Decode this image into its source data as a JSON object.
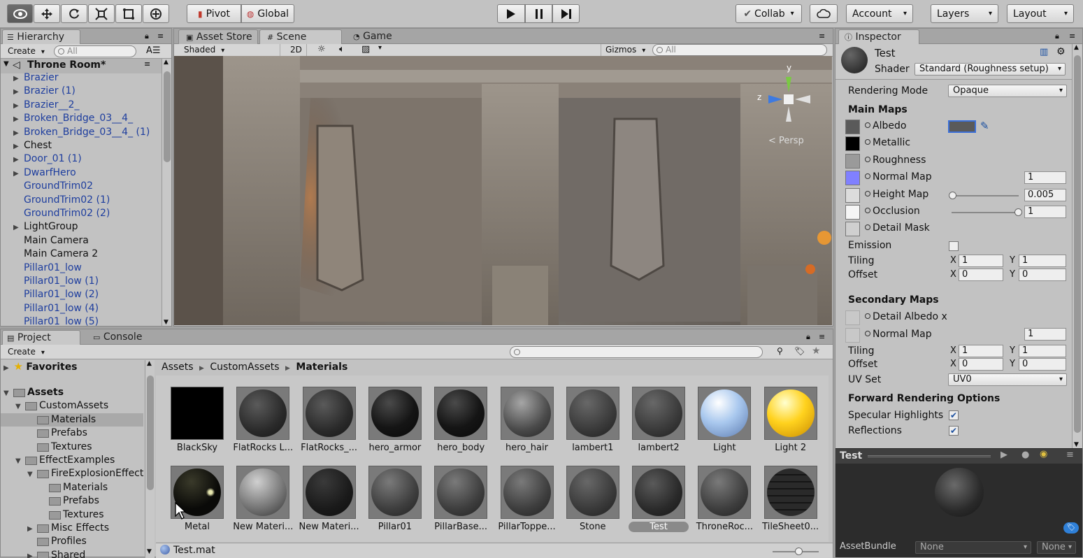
{
  "toolbar": {
    "pivot": "Pivot",
    "global": "Global",
    "collab": "Collab",
    "account": "Account",
    "layers": "Layers",
    "layout": "Layout"
  },
  "hierarchy": {
    "tab": "Hierarchy",
    "create": "Create",
    "search_placeholder": "All",
    "scene_name": "Throne Room*",
    "items": [
      {
        "label": "Brazier",
        "prefab": true,
        "expandable": true
      },
      {
        "label": "Brazier (1)",
        "prefab": true,
        "expandable": true
      },
      {
        "label": "Brazier__2_",
        "prefab": true,
        "expandable": true
      },
      {
        "label": "Broken_Bridge_03__4_",
        "prefab": true,
        "expandable": true
      },
      {
        "label": "Broken_Bridge_03__4_ (1)",
        "prefab": true,
        "expandable": true
      },
      {
        "label": "Chest",
        "prefab": false,
        "expandable": true
      },
      {
        "label": "Door_01 (1)",
        "prefab": true,
        "expandable": true
      },
      {
        "label": "DwarfHero",
        "prefab": true,
        "expandable": true
      },
      {
        "label": "GroundTrim02",
        "prefab": true,
        "expandable": false
      },
      {
        "label": "GroundTrim02 (1)",
        "prefab": true,
        "expandable": false
      },
      {
        "label": "GroundTrim02 (2)",
        "prefab": true,
        "expandable": false
      },
      {
        "label": "LightGroup",
        "prefab": false,
        "expandable": true
      },
      {
        "label": "Main Camera",
        "prefab": false,
        "expandable": false
      },
      {
        "label": "Main Camera 2",
        "prefab": false,
        "expandable": false
      },
      {
        "label": "Pillar01_low",
        "prefab": true,
        "expandable": false
      },
      {
        "label": "Pillar01_low (1)",
        "prefab": true,
        "expandable": false
      },
      {
        "label": "Pillar01_low (2)",
        "prefab": true,
        "expandable": false
      },
      {
        "label": "Pillar01_low (4)",
        "prefab": true,
        "expandable": false
      },
      {
        "label": "Pillar01_low (5)",
        "prefab": true,
        "expandable": false
      }
    ]
  },
  "scene_view": {
    "tabs": [
      "Asset Store",
      "Scene",
      "Game"
    ],
    "shading": "Shaded",
    "mode_2d": "2D",
    "gizmos": "Gizmos",
    "search_placeholder": "All",
    "persp": "< Persp",
    "axis_y": "y",
    "axis_z": "z"
  },
  "project": {
    "tabs": [
      "Project",
      "Console"
    ],
    "create": "Create",
    "favorites": "Favorites",
    "tree": [
      {
        "label": "Assets",
        "depth": 0,
        "open": true,
        "bold": true
      },
      {
        "label": "CustomAssets",
        "depth": 1,
        "open": true
      },
      {
        "label": "Materials",
        "depth": 2,
        "selected": true
      },
      {
        "label": "Prefabs",
        "depth": 2
      },
      {
        "label": "Textures",
        "depth": 2
      },
      {
        "label": "EffectExamples",
        "depth": 1,
        "open": true
      },
      {
        "label": "FireExplosionEffects",
        "depth": 2,
        "open": true
      },
      {
        "label": "Materials",
        "depth": 3
      },
      {
        "label": "Prefabs",
        "depth": 3
      },
      {
        "label": "Textures",
        "depth": 3
      },
      {
        "label": "Misc Effects",
        "depth": 2,
        "closed": true
      },
      {
        "label": "Profiles",
        "depth": 2
      },
      {
        "label": "Shared",
        "depth": 2,
        "closed": true
      }
    ],
    "breadcrumb": [
      "Assets",
      "CustomAssets",
      "Materials"
    ],
    "assets": [
      {
        "label": "BlackSky",
        "look": "black"
      },
      {
        "label": "FlatRocks L...",
        "look": "rock"
      },
      {
        "label": "FlatRocks_...",
        "look": "rock"
      },
      {
        "label": "hero_armor",
        "look": "dark"
      },
      {
        "label": "hero_body",
        "look": "dark"
      },
      {
        "label": "hero_hair",
        "look": "mid"
      },
      {
        "label": "lambert1",
        "look": "dim"
      },
      {
        "label": "lambert2",
        "look": "dim"
      },
      {
        "label": "Light",
        "look": "blue"
      },
      {
        "label": "Light 2",
        "look": "yellow"
      },
      {
        "label": "Metal",
        "look": "metal"
      },
      {
        "label": "New Materi...",
        "look": "grey"
      },
      {
        "label": "New Materi...",
        "look": "darkmatte"
      },
      {
        "label": "Pillar01",
        "look": "stone"
      },
      {
        "label": "PillarBase...",
        "look": "stone"
      },
      {
        "label": "PillarToppe...",
        "look": "stone"
      },
      {
        "label": "Stone",
        "look": "dim"
      },
      {
        "label": "Test",
        "look": "rock",
        "selected": true
      },
      {
        "label": "ThroneRoc...",
        "look": "stone"
      },
      {
        "label": "TileSheet0...",
        "look": "tile"
      }
    ],
    "status_file": "Test.mat"
  },
  "inspector": {
    "tab": "Inspector",
    "material_name": "Test",
    "shader_label": "Shader",
    "shader_value": "Standard (Roughness setup)",
    "rendering_mode_label": "Rendering Mode",
    "rendering_mode_value": "Opaque",
    "main_maps": "Main Maps",
    "maps": [
      {
        "label": "Albedo",
        "swatch": "#5a5a5a"
      },
      {
        "label": "Metallic",
        "swatch": "#000000"
      },
      {
        "label": "Roughness",
        "swatch": "#9a9a9a"
      },
      {
        "label": "Normal Map",
        "swatch": "#8080ff",
        "value": "1"
      },
      {
        "label": "Height Map",
        "swatch": "#dcdcdc",
        "value": "0.005",
        "slider": 0
      },
      {
        "label": "Occlusion",
        "swatch": "#f5f5f5",
        "value": "1",
        "slider": 1
      },
      {
        "label": "Detail Mask",
        "swatch": "#cfcfcf"
      }
    ],
    "emission": "Emission",
    "tiling": "Tiling",
    "offset": "Offset",
    "x": "X",
    "y": "Y",
    "tiling_x": "1",
    "tiling_y": "1",
    "offset_x": "0",
    "offset_y": "0",
    "secondary_maps": "Secondary Maps",
    "detail_albedo": "Detail Albedo x",
    "sec_normal": "Normal Map",
    "sec_normal_value": "1",
    "sec_tiling_x": "1",
    "sec_tiling_y": "1",
    "sec_offset_x": "0",
    "sec_offset_y": "0",
    "uv_set_label": "UV Set",
    "uv_set_value": "UV0",
    "forward_options": "Forward Rendering Options",
    "specular": "Specular Highlights",
    "reflections": "Reflections",
    "preview_title": "Test",
    "assetbundle_label": "AssetBundle",
    "assetbundle_value": "None",
    "assetbundle_variant": "None"
  }
}
